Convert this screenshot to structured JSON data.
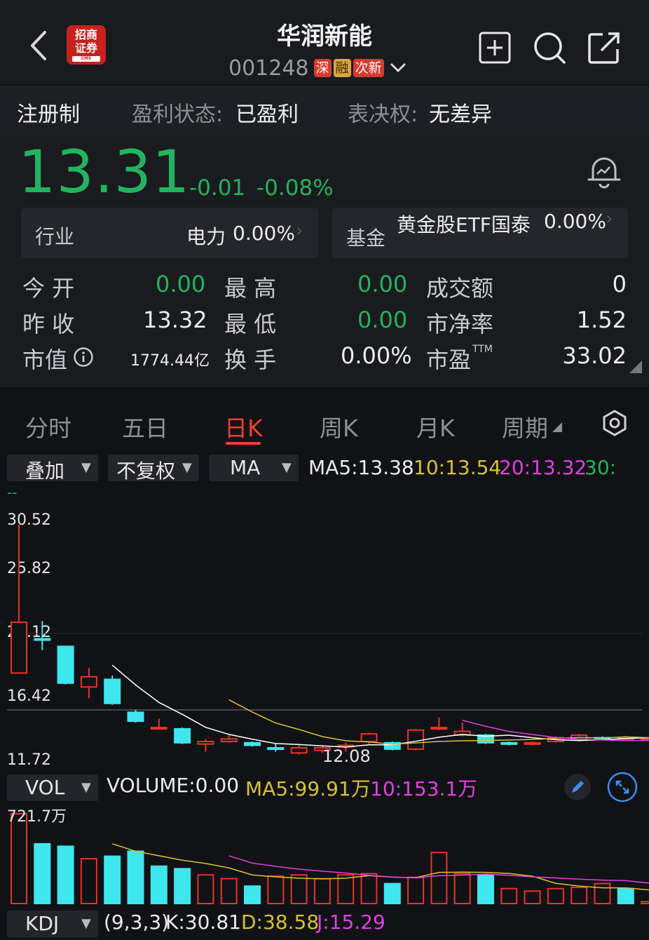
{
  "header": {
    "title": "华润新能",
    "code": "001248",
    "tags": [
      "深",
      "融",
      "次新"
    ],
    "logo_text": "招商证券",
    "logo_sub": "CMS"
  },
  "info": {
    "reg": "注册制",
    "profit_label": "盈利状态:",
    "profit_value": "已盈利",
    "vote_label": "表决权:",
    "vote_value": "无差异"
  },
  "quote": {
    "price": "13.31",
    "change": "-0.01",
    "change_pct": "-0.08%"
  },
  "industry": {
    "label": "行业",
    "name": "电力",
    "pct": "0.00%"
  },
  "fund": {
    "label": "基金",
    "name": "黄金股ETF国泰",
    "pct": "0.00%"
  },
  "stats": {
    "open_label": "今    开",
    "open": "0.00",
    "high_label": "最    高",
    "high": "0.00",
    "turnover_label": "成交额",
    "turnover": "0",
    "prev_label": "昨    收",
    "prev": "13.32",
    "low_label": "最    低",
    "low": "0.00",
    "pb_label": "市净率",
    "pb": "1.52",
    "mcap_label": "市值",
    "mcap": "1774.44亿",
    "exch_label": "换    手",
    "exch": "0.00%",
    "pe_label": "市盈",
    "pe_sup": "TTM",
    "pe": "33.02"
  },
  "tabs": [
    "分时",
    "五日",
    "日K",
    "周K",
    "月K",
    "周期"
  ],
  "controls": {
    "overlay": "叠加",
    "adjust": "不复权",
    "indicator": "MA"
  },
  "ma": {
    "ma5": "MA5:13.38",
    "ma10": "10:13.54",
    "ma20": "20:13.32",
    "ma30": "30:",
    "ma30_val": "--"
  },
  "price_axis": [
    "30.52",
    "25.82",
    "21.12",
    "16.42",
    "11.72"
  ],
  "low_marker": "12.08",
  "volume": {
    "selector": "VOL",
    "label": "VOLUME:0.00",
    "ma5": "MA5:99.91万",
    "ma10": "10:153.1万",
    "max": "721.7万"
  },
  "kdj": {
    "selector": "KDJ",
    "params": "(9,3,3)",
    "k": "K:30.81",
    "d": "D:38.58",
    "j": "J:15.29"
  },
  "colors": {
    "up": "#e8322a",
    "down": "#3ee6ee",
    "green": "#22b35e",
    "ma5": "#ffffff",
    "ma10": "#d8c030",
    "ma20": "#e040e0"
  },
  "chart_data": {
    "type": "candlestick",
    "ylim": [
      11.72,
      30.52
    ],
    "candles": [
      {
        "o": 18.5,
        "c": 22.5,
        "h": 30.2,
        "l": 18.5
      },
      {
        "o": 21.2,
        "c": 21.1,
        "h": 22.6,
        "l": 20.3
      },
      {
        "o": 20.6,
        "c": 17.7,
        "h": 20.6,
        "l": 17.6
      },
      {
        "o": 17.4,
        "c": 18.2,
        "h": 18.9,
        "l": 16.5
      },
      {
        "o": 18.0,
        "c": 16.1,
        "h": 18.3,
        "l": 16.0
      },
      {
        "o": 15.4,
        "c": 14.7,
        "h": 15.6,
        "l": 14.6
      },
      {
        "o": 14.2,
        "c": 14.2,
        "h": 14.9,
        "l": 14.1
      },
      {
        "o": 14.1,
        "c": 13.0,
        "h": 14.2,
        "l": 12.9
      },
      {
        "o": 12.9,
        "c": 13.1,
        "h": 13.3,
        "l": 12.3
      },
      {
        "o": 13.1,
        "c": 13.3,
        "h": 13.6,
        "l": 13.0
      },
      {
        "o": 13.0,
        "c": 12.8,
        "h": 13.1,
        "l": 12.7
      },
      {
        "o": 12.6,
        "c": 12.5,
        "h": 12.9,
        "l": 12.3
      },
      {
        "o": 12.2,
        "c": 12.6,
        "h": 12.8,
        "l": 12.08
      },
      {
        "o": 12.4,
        "c": 12.6,
        "h": 12.8,
        "l": 12.2
      },
      {
        "o": 12.8,
        "c": 12.8,
        "h": 13.0,
        "l": 12.3
      },
      {
        "o": 13.1,
        "c": 13.7,
        "h": 13.8,
        "l": 12.9
      },
      {
        "o": 13.0,
        "c": 12.5,
        "h": 13.1,
        "l": 12.4
      },
      {
        "o": 12.5,
        "c": 14.0,
        "h": 14.1,
        "l": 12.4
      },
      {
        "o": 14.1,
        "c": 14.2,
        "h": 15.0,
        "l": 14.0
      },
      {
        "o": 13.6,
        "c": 13.9,
        "h": 14.6,
        "l": 13.5
      },
      {
        "o": 13.6,
        "c": 13.0,
        "h": 13.7,
        "l": 12.9
      },
      {
        "o": 13.0,
        "c": 12.9,
        "h": 13.1,
        "l": 12.8
      },
      {
        "o": 12.9,
        "c": 13.0,
        "h": 13.1,
        "l": 12.8
      },
      {
        "o": 13.1,
        "c": 13.4,
        "h": 13.5,
        "l": 13.0
      },
      {
        "o": 13.2,
        "c": 13.6,
        "h": 13.7,
        "l": 13.1
      },
      {
        "o": 13.4,
        "c": 13.3,
        "h": 13.5,
        "l": 13.2
      },
      {
        "o": 13.3,
        "c": 13.4,
        "h": 13.5,
        "l": 13.2
      },
      {
        "o": 13.3,
        "c": 13.31,
        "h": 13.4,
        "l": 13.2
      }
    ],
    "volumes": [
      721.7,
      480,
      460,
      360,
      380,
      420,
      300,
      280,
      230,
      200,
      140,
      220,
      230,
      200,
      230,
      240,
      160,
      210,
      410,
      240,
      230,
      120,
      100,
      120,
      130,
      160,
      120,
      15
    ],
    "volume_up": [
      true,
      false,
      false,
      true,
      false,
      false,
      false,
      false,
      true,
      true,
      false,
      true,
      true,
      true,
      true,
      true,
      false,
      true,
      true,
      true,
      false,
      true,
      true,
      true,
      true,
      true,
      false,
      true
    ]
  }
}
